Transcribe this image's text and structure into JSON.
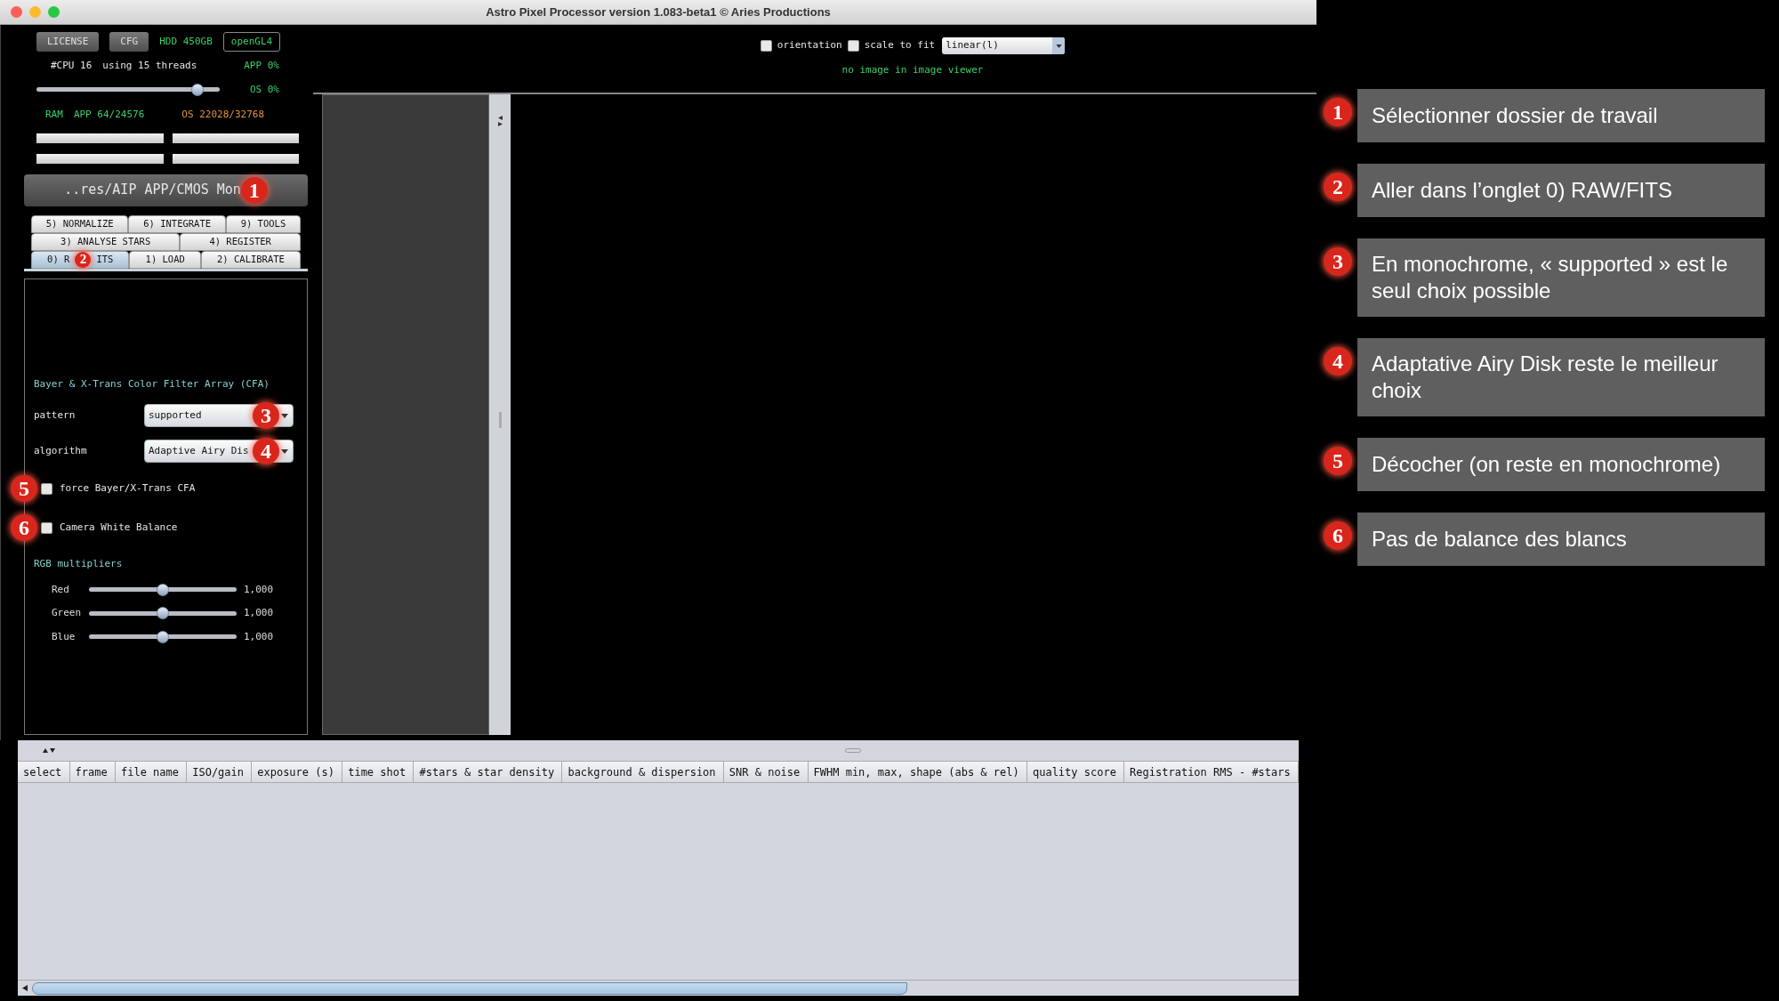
{
  "window": {
    "title": "Astro Pixel Processor version 1.083-beta1 © Aries Productions"
  },
  "system": {
    "buttons": [
      {
        "label": "LICENSE"
      },
      {
        "label": "CFG"
      }
    ],
    "hdd": "HDD 450GB",
    "renderer": "openGL4",
    "cpu": "#CPU 16",
    "threads": "using 15 threads",
    "app_cpu": "APP 0%",
    "threads_slider": {
      "level": 0.88
    },
    "os_cpu": "OS 0%",
    "ram_label": "RAM",
    "ram_app": "APP 64/24576",
    "ram_os": "OS 22028/32768"
  },
  "folder_button": {
    "label": "..res/AIP APP/CMOS Mon",
    "step": "1"
  },
  "tab_rows": [
    {
      "tabs": [
        {
          "label": "5) NORMALIZE",
          "selected": false
        },
        {
          "label": "6) INTEGRATE",
          "selected": false
        },
        {
          "label": "9) TOOLS",
          "selected": false
        }
      ]
    },
    {
      "tabs": [
        {
          "label": "3) ANALYSE STARS",
          "selected": false
        },
        {
          "label": "4) REGISTER",
          "selected": false
        }
      ]
    },
    {
      "tabs": [
        {
          "label": "0) R",
          "label_after": "ITS",
          "step": "2",
          "selected": true
        },
        {
          "label": "1) LOAD",
          "selected": false
        },
        {
          "label": "2) CALIBRATE",
          "selected": false
        }
      ]
    }
  ],
  "cfa": {
    "heading": "Bayer & X-Trans Color Filter Array (CFA)",
    "fields": [
      {
        "label": "pattern",
        "value": "supported",
        "step": "3"
      },
      {
        "label": "algorithm",
        "value": "Adaptive Airy Dis",
        "step": "4"
      }
    ],
    "checkboxes": [
      {
        "label": "force Bayer/X-Trans CFA",
        "checked": false,
        "step": "5"
      },
      {
        "label": "Camera White Balance",
        "checked": false,
        "step": "6"
      }
    ],
    "rgb_heading": "RGB multipliers",
    "sliders": [
      {
        "name": "Red",
        "level": 0.5,
        "reading": "1,000"
      },
      {
        "name": "Green",
        "level": 0.5,
        "reading": "1,000"
      },
      {
        "name": "Blue",
        "level": 0.5,
        "reading": "1,000"
      }
    ]
  },
  "viewer": {
    "options": [
      {
        "label": "orientation",
        "checked": false
      },
      {
        "label": "scale to fit",
        "checked": false
      }
    ],
    "stretch": "linear(l)",
    "message": "no image in image viewer"
  },
  "table": {
    "columns": [
      "select",
      "frame",
      "file name",
      "ISO/gain",
      "exposure (s)",
      "time shot",
      "#stars & star density",
      "background & dispersion",
      "SNR & noise",
      "FWHM min, max, shape (abs & rel)",
      "quality score",
      "Registration RMS - #stars"
    ]
  },
  "notes": [
    {
      "step": "1",
      "text": "Sélectionner dossier de travail"
    },
    {
      "step": "2",
      "text": "Aller dans l’onglet 0) RAW/FITS"
    },
    {
      "step": "3",
      "text": "En monochrome, « supported » est le seul choix possible"
    },
    {
      "step": "4",
      "text": "Adaptative Airy Disk reste le meilleur choix"
    },
    {
      "step": "5",
      "text": "Décocher (on reste en monochrome)"
    },
    {
      "step": "6",
      "text": "Pas de balance des blancs"
    }
  ]
}
